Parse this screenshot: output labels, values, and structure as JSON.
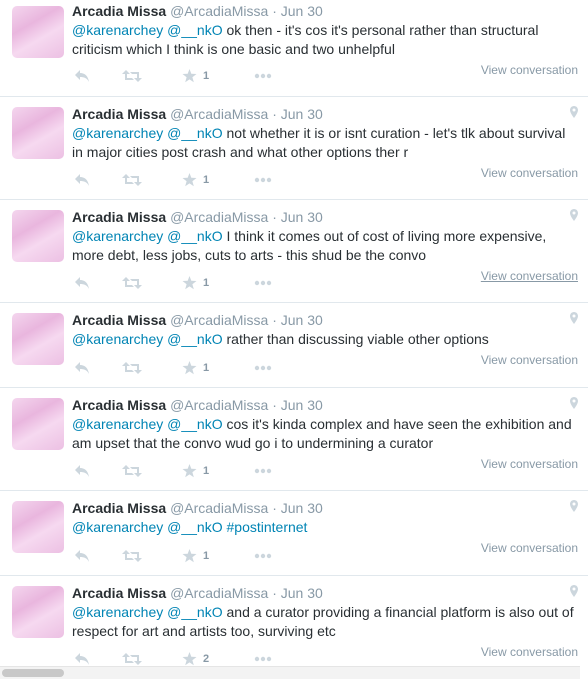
{
  "tweets": [
    {
      "fullname": "Arcadia Missa",
      "username": "@ArcadiaMissa",
      "time": "Jun 30",
      "mentions": "",
      "text": "@karenarchey @__nkO ok then - it's cos it's personal rather than structural criticism which I think is one basic and two unhelpful",
      "line1_m": "@karenarchey @__nkO",
      "line1_t": " ok then - it's cos it's personal rather than structural",
      "line2": "criticism which I think is one basic and two unhelpful",
      "favorites": "1",
      "view_label": "View conversation",
      "has_geo": false
    },
    {
      "fullname": "Arcadia Missa",
      "username": "@ArcadiaMissa",
      "time": "Jun 30",
      "line1_m": "@karenarchey @__nkO",
      "line1_t": " not whether it is or isnt curation - let's tlk about survival",
      "line2": "in major cities post crash and what other options ther r",
      "favorites": "1",
      "view_label": "View conversation",
      "has_geo": true
    },
    {
      "fullname": "Arcadia Missa",
      "username": "@ArcadiaMissa",
      "time": "Jun 30",
      "line1_m": "@karenarchey @__nkO",
      "line1_t": " I think it comes out of cost of living more expensive,",
      "line2": "more debt, less jobs, cuts to arts - this shud be the convo",
      "favorites": "1",
      "view_label": "View conversation",
      "has_geo": true
    },
    {
      "fullname": "Arcadia Missa",
      "username": "@ArcadiaMissa",
      "time": "Jun 30",
      "line1_m": "@karenarchey @__nkO",
      "line1_t": " rather than discussing viable other options",
      "line2": "",
      "favorites": "1",
      "view_label": "View conversation",
      "has_geo": true
    },
    {
      "fullname": "Arcadia Missa",
      "username": "@ArcadiaMissa",
      "time": "Jun 30",
      "line1_m": "@karenarchey @__nkO",
      "line1_t": " cos it's kinda complex and have seen the exhibition and",
      "line2": "am upset that the convo wud go i to undermining a curator",
      "favorites": "1",
      "view_label": "View conversation",
      "has_geo": true
    },
    {
      "fullname": "Arcadia Missa",
      "username": "@ArcadiaMissa",
      "time": "Jun 30",
      "line1_m": "@karenarchey @__nkO #postinternet",
      "line1_t": "",
      "line2": "",
      "favorites": "1",
      "view_label": "View conversation",
      "has_geo": true
    },
    {
      "fullname": "Arcadia Missa",
      "username": "@ArcadiaMissa",
      "time": "Jun 30",
      "line1_m": "@karenarchey @__nkO",
      "line1_t": " and a curator providing a financial platform is also out of",
      "line2": "respect for art and artists too, surviving etc",
      "favorites": "2",
      "view_label": "View conversation",
      "has_geo": true
    }
  ],
  "colors": {
    "link": "#0084b4",
    "muted": "#8899a6",
    "icon": "#ccd6dd",
    "text": "#292f33"
  },
  "icons": [
    "reply-icon",
    "retweet-icon",
    "star-icon",
    "more-icon",
    "geo-pin-icon"
  ]
}
